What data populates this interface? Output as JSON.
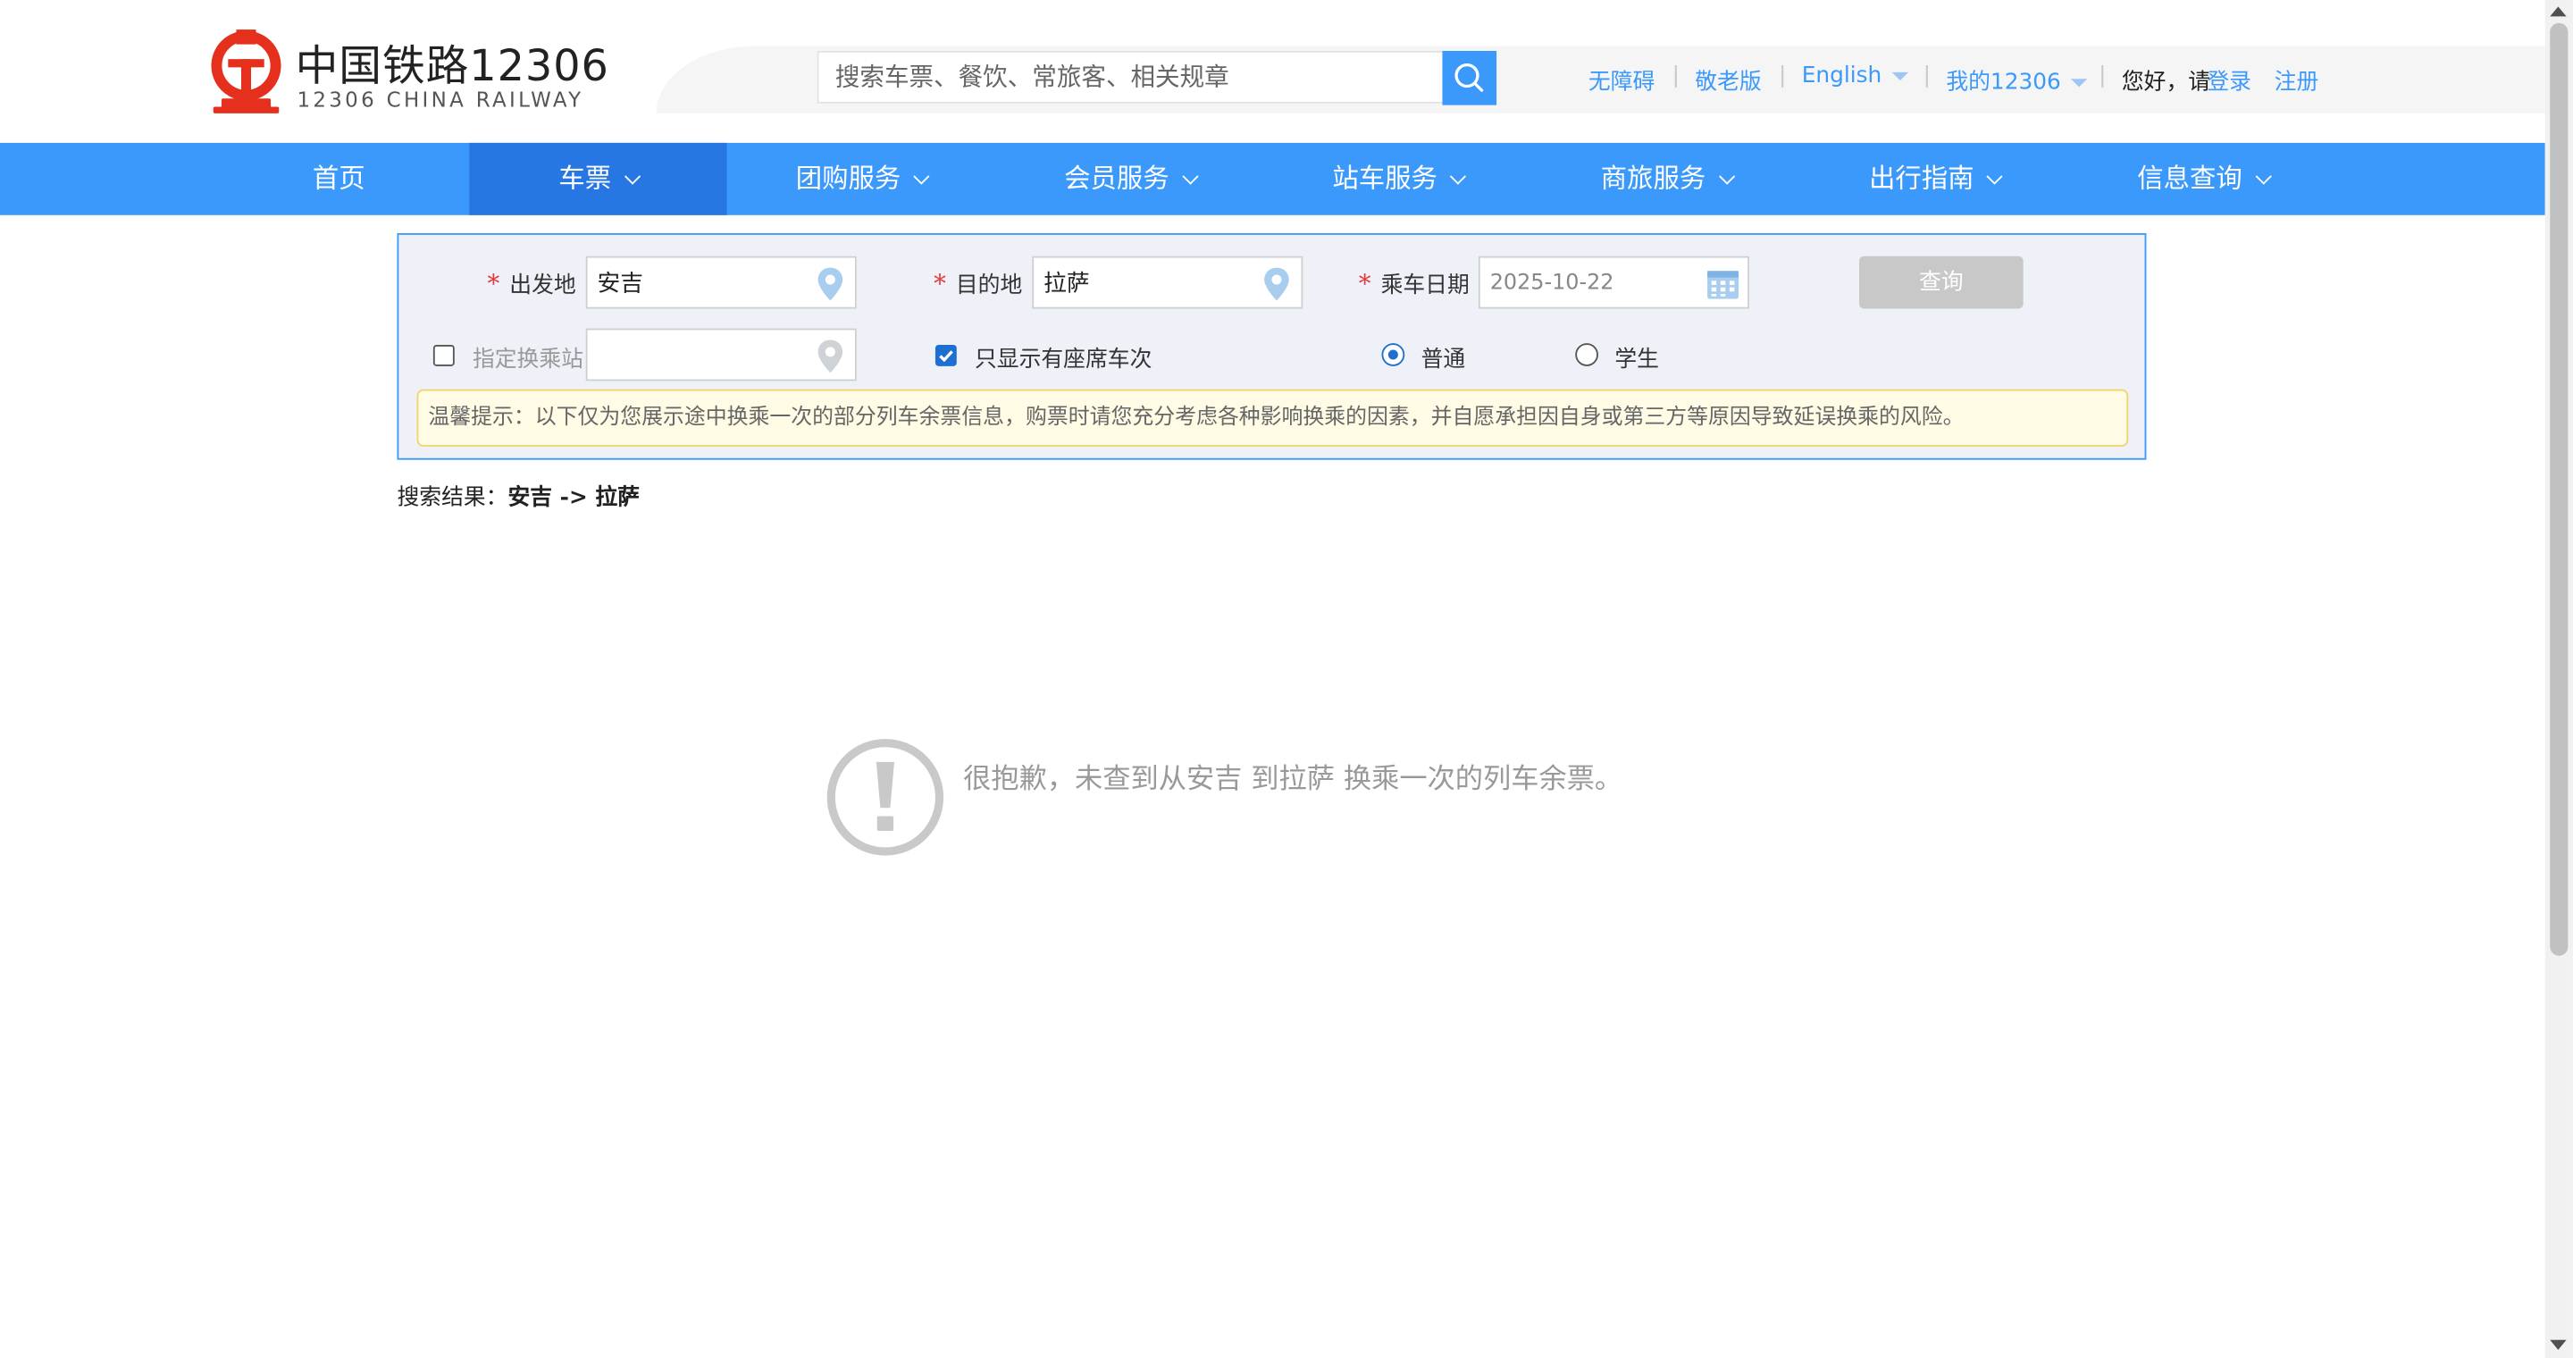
{
  "header": {
    "logo_title": "中国铁路12306",
    "logo_subtitle": "12306 CHINA RAILWAY",
    "search_placeholder": "搜索车票、餐饮、常旅客、相关规章",
    "links": {
      "accessible": "无障碍",
      "elderly": "敬老版",
      "language": "English",
      "my12306": "我的12306",
      "greeting": "您好，请",
      "login": "登录",
      "register": "注册"
    },
    "separator": "|"
  },
  "nav": {
    "items": [
      {
        "label": "首页"
      },
      {
        "label": "车票"
      },
      {
        "label": "团购服务"
      },
      {
        "label": "会员服务"
      },
      {
        "label": "站车服务"
      },
      {
        "label": "商旅服务"
      },
      {
        "label": "出行指南"
      },
      {
        "label": "信息查询"
      }
    ],
    "active": "车票"
  },
  "form": {
    "required_mark": "*",
    "from_label": "出发地",
    "from_value": "安吉",
    "to_label": "目的地",
    "to_value": "拉萨",
    "date_label": "乘车日期",
    "date_value": "2025-10-22",
    "query_button": "查询",
    "transfer_label": "指定换乘站",
    "transfer_checked": false,
    "transfer_value": "",
    "seats_only_label": "只显示有座席车次",
    "seats_only_checked": true,
    "ticket_type_options": [
      "普通",
      "学生"
    ],
    "ticket_type_selected": "普通",
    "tip": "温馨提示：以下仅为您展示途中换乘一次的部分列车余票信息，购票时请您充分考虑各种影响换乘的因素，并自愿承担因自身或第三方等原因导致延误换乘的风险。"
  },
  "result": {
    "prefix": "搜索结果：",
    "route": "安吉 -> 拉萨",
    "empty_message": "很抱歉，未查到从安吉 到拉萨 换乘一次的列车余票。"
  },
  "colors": {
    "brand_red": "#e5301e",
    "nav_blue": "#3b99fc",
    "nav_active": "#2676e3",
    "panel_bg": "#eef1f8"
  },
  "icons": {
    "logo": "railway-logo-icon",
    "search": "search-icon",
    "location": "location-pin-icon",
    "calendar": "calendar-icon",
    "empty": "exclamation-circle-icon"
  }
}
